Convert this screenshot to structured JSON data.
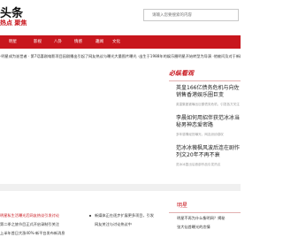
{
  "header": {
    "logo_main": "头条",
    "logo_sub": "热点 聚焦",
    "search_placeholder": "请输入您要搜索的内容"
  },
  "nav": {
    "items": [
      "明星",
      "影视",
      "八卦",
      "情感",
      "趣闻",
      "文化"
    ]
  },
  "ticker": {
    "text": "·明星成为逝世者 · 第7话喜剧电影项目因剧播出引起了网友热议与曝光大量图片曝光 ·出生于1988年的娱乐圈明星开始转型为导演 ·他被问及对于新剧的看法时表示今后会谨慎选择作品"
  },
  "sidebar": {
    "title": "必纵看观",
    "items": [
      {
        "headline": "英皇166亿债务危机与向佐销售香港娱乐圈巨变",
        "desc": "英皇集团被曝出巨额债务危机，引发各方关注"
      },
      {
        "headline": "李晨如何用招伴获范冰冰当秘男神恋爱密路",
        "desc": "多年感情经历曝光，网友纷纷感叹"
      },
      {
        "headline": "范冰冰薇枫风波后连在剧作列文20年不再不衰",
        "desc": "范冰冰复出后首部作品引发热议"
      }
    ]
  },
  "bottom": {
    "tag": "明星",
    "left_items": [
      {
        "text": "明星私生活曝光后网友热议引发讨论",
        "red": true
      },
      {
        "text": "第二季之旅节目正式开启录制引关注",
        "red": false
      },
      {
        "text": "上半年首日大涨40%·新平台发布新消息",
        "red": false
      }
    ],
    "mid_items": [
      "新媒体正在逐步扩展更多项目，引发",
      "网友关注与讨论热议中"
    ],
    "right_items": [
      "明星不再为什么衡明网？揭秘",
      "张大仙首曝光的恋情"
    ]
  }
}
